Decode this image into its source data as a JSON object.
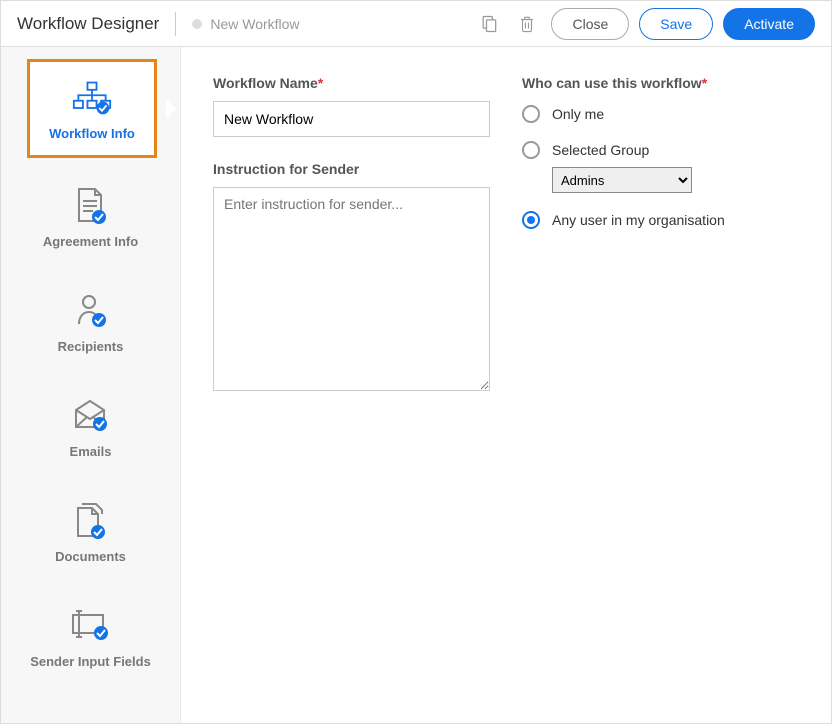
{
  "header": {
    "title": "Workflow Designer",
    "breadcrumb": "New Workflow",
    "close_label": "Close",
    "save_label": "Save",
    "activate_label": "Activate"
  },
  "sidebar": {
    "items": [
      {
        "label": "Workflow Info"
      },
      {
        "label": "Agreement Info"
      },
      {
        "label": "Recipients"
      },
      {
        "label": "Emails"
      },
      {
        "label": "Documents"
      },
      {
        "label": "Sender Input Fields"
      }
    ]
  },
  "form": {
    "workflow_name_label": "Workflow Name",
    "workflow_name_value": "New Workflow",
    "instruction_label": "Instruction for Sender",
    "instruction_placeholder": "Enter instruction for sender...",
    "who_can_use_label": "Who can use this workflow",
    "radio_only_me": "Only me",
    "radio_selected_group": "Selected Group",
    "select_group_value": "Admins",
    "radio_any_user": "Any user in my organisation",
    "selected_radio": "any_user"
  }
}
